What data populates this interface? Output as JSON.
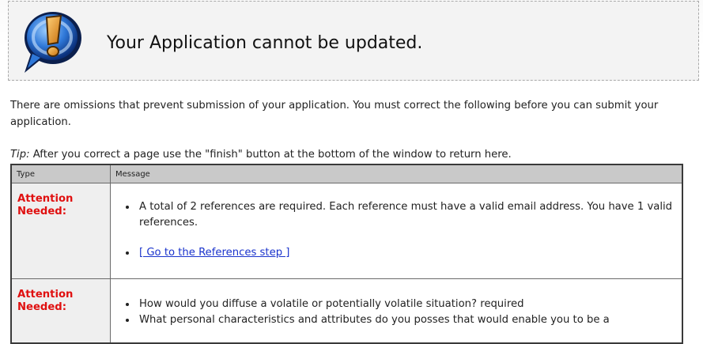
{
  "banner": {
    "title": "Your Application cannot be updated.",
    "icon": "exclamation-speech-bubble-icon"
  },
  "intro": {
    "text": "There are omissions that prevent submission of your application. You must correct the following before you can submit your application."
  },
  "tip": {
    "label": "Tip:",
    "text": " After you correct a page use the \"finish\" button at the bottom of the window to return here."
  },
  "table": {
    "headers": {
      "type": "Type",
      "message": "Message"
    },
    "rows": [
      {
        "type": "Attention Needed:",
        "items": [
          "A total of 2 references are required. Each reference must have a valid email address. You have 1 valid references."
        ],
        "link": "[ Go to the References step ]"
      },
      {
        "type": "Attention Needed:",
        "items": [
          "How would you diffuse a volatile or potentially volatile situation? required",
          "What personal characteristics and attributes do you posses that would enable you to be a"
        ]
      }
    ]
  },
  "colors": {
    "attention": "#e01010",
    "link": "#1a33cc",
    "header_bg": "#c9c9c9"
  }
}
